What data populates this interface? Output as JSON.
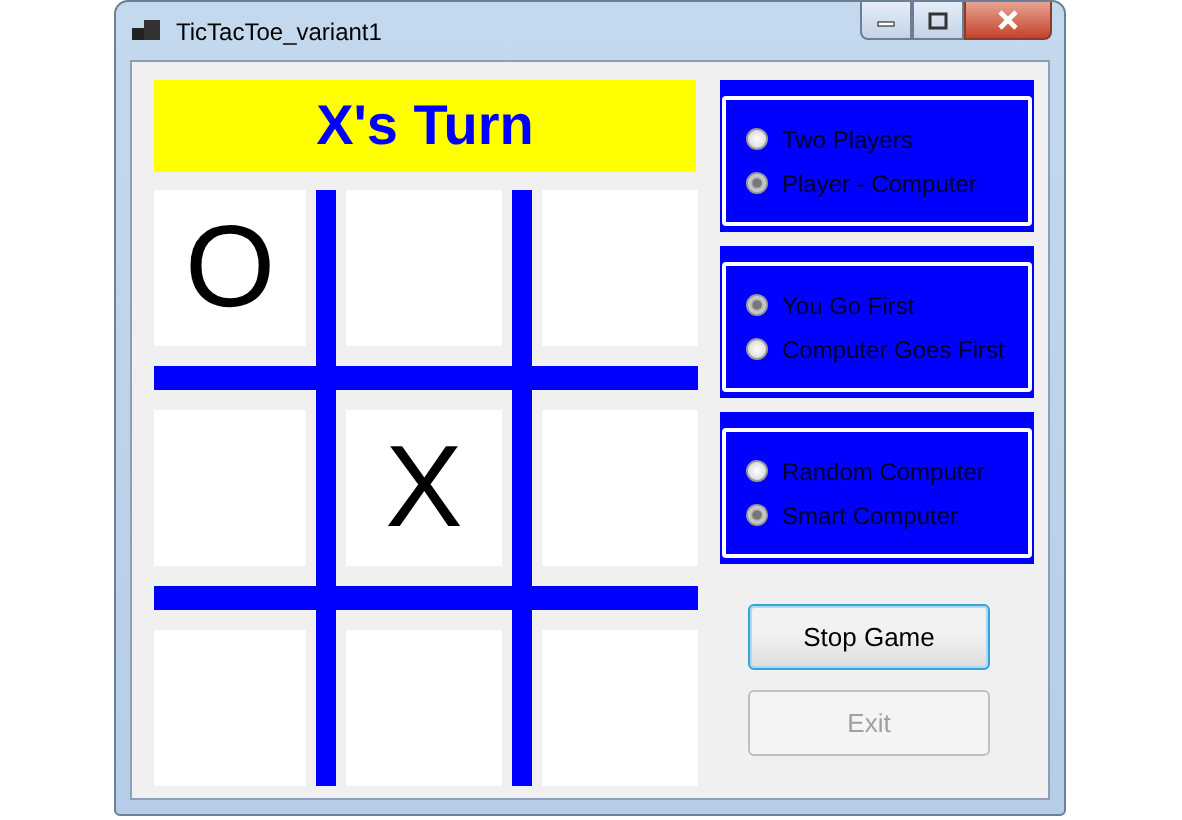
{
  "window": {
    "title": "TicTacToe_variant1"
  },
  "turn_banner": "X's Turn",
  "board": {
    "cells": [
      {
        "mark": "O"
      },
      {},
      {},
      {},
      {
        "mark": "X"
      },
      {},
      {},
      {},
      {}
    ]
  },
  "option_groups": [
    {
      "options": [
        {
          "label": "Two Players",
          "selected": false
        },
        {
          "label": "Player - Computer",
          "selected": true
        }
      ]
    },
    {
      "options": [
        {
          "label": "You Go First",
          "selected": true
        },
        {
          "label": "Computer Goes First",
          "selected": false
        }
      ]
    },
    {
      "options": [
        {
          "label": "Random Computer",
          "selected": false
        },
        {
          "label": "Smart Computer",
          "selected": true
        }
      ]
    }
  ],
  "buttons": [
    {
      "label": "Stop Game",
      "disabled": false,
      "focused": true
    },
    {
      "label": "Exit",
      "disabled": true,
      "focused": false
    }
  ]
}
